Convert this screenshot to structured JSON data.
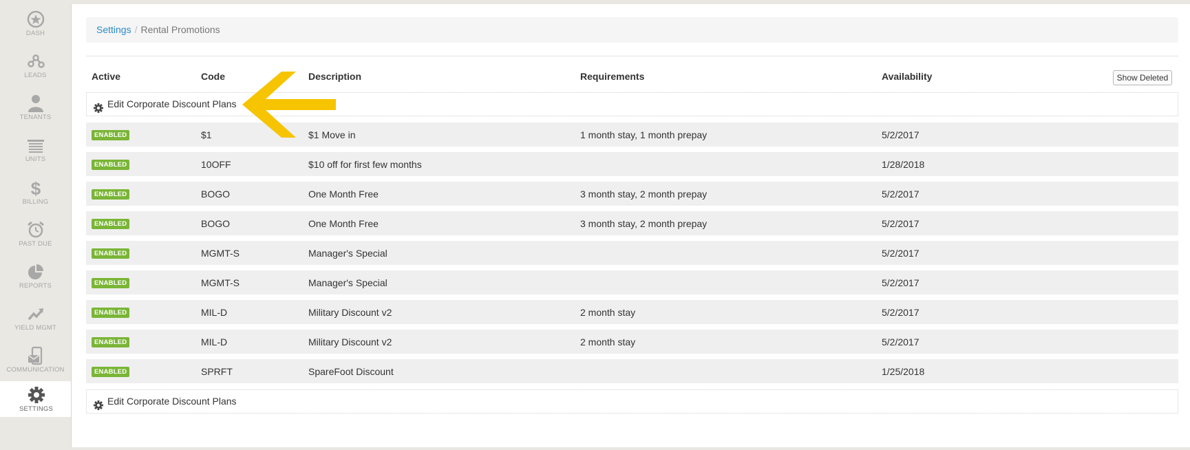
{
  "sidebar": {
    "items": [
      {
        "label": "DASH",
        "icon": "star-icon"
      },
      {
        "label": "LEADS",
        "icon": "network-icon"
      },
      {
        "label": "TENANTS",
        "icon": "person-icon"
      },
      {
        "label": "UNITS",
        "icon": "storage-unit-icon"
      },
      {
        "label": "BILLING",
        "icon": "dollar-icon"
      },
      {
        "label": "PAST DUE",
        "icon": "alarm-clock-icon"
      },
      {
        "label": "REPORTS",
        "icon": "pie-chart-icon"
      },
      {
        "label": "YIELD MGMT",
        "icon": "trend-up-icon"
      },
      {
        "label": "COMMUNICATION",
        "icon": "phone-mail-icon"
      },
      {
        "label": "SETTINGS",
        "icon": "gear-icon"
      }
    ],
    "active": "SETTINGS"
  },
  "breadcrumb": {
    "link": "Settings",
    "separator": "/",
    "current": "Rental Promotions"
  },
  "table": {
    "headers": {
      "active": "Active",
      "code": "Code",
      "description": "Description",
      "requirements": "Requirements",
      "availability": "Availability"
    },
    "show_deleted_label": "Show Deleted",
    "edit_plans_label": "Edit Corporate Discount Plans",
    "rows": [
      {
        "status": "ENABLED",
        "code": "$1",
        "description": "$1 Move in",
        "requirements": "1 month stay, 1 month prepay",
        "availability": "5/2/2017"
      },
      {
        "status": "ENABLED",
        "code": "10OFF",
        "description": "$10 off for first few months",
        "requirements": "",
        "availability": "1/28/2018"
      },
      {
        "status": "ENABLED",
        "code": "BOGO",
        "description": "One Month Free",
        "requirements": "3 month stay, 2 month prepay",
        "availability": "5/2/2017"
      },
      {
        "status": "ENABLED",
        "code": "BOGO",
        "description": "One Month Free",
        "requirements": "3 month stay, 2 month prepay",
        "availability": "5/2/2017"
      },
      {
        "status": "ENABLED",
        "code": "MGMT-S",
        "description": "Manager's Special",
        "requirements": "",
        "availability": "5/2/2017"
      },
      {
        "status": "ENABLED",
        "code": "MGMT-S",
        "description": "Manager's Special",
        "requirements": "",
        "availability": "5/2/2017"
      },
      {
        "status": "ENABLED",
        "code": "MIL-D",
        "description": "Military Discount v2",
        "requirements": "2 month stay",
        "availability": "5/2/2017"
      },
      {
        "status": "ENABLED",
        "code": "MIL-D",
        "description": "Military Discount v2",
        "requirements": "2 month stay",
        "availability": "5/2/2017"
      },
      {
        "status": "ENABLED",
        "code": "SPRFT",
        "description": "SpareFoot Discount",
        "requirements": "",
        "availability": "1/25/2018"
      }
    ]
  },
  "colors": {
    "link": "#2a8bc8",
    "enabled_badge": "#7ab536",
    "annotation_arrow": "#f6c400"
  }
}
